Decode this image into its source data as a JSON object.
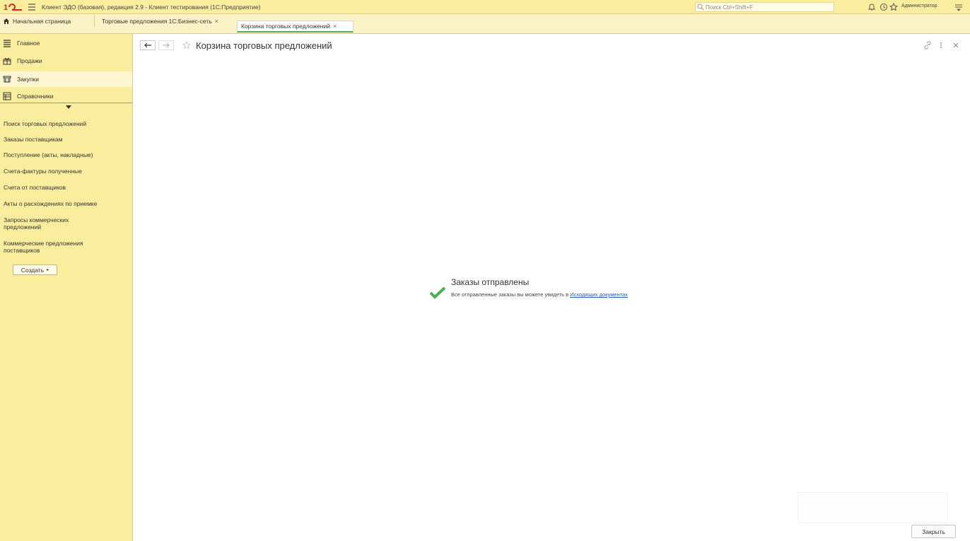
{
  "titlebar": {
    "app_title": "Клиент ЭДО (базовая), редакция 2.9 - Клиент тестирования (1С:Предприятие)",
    "search_placeholder": "Поиск Ctrl+Shift+F",
    "user": "Администратор"
  },
  "tabs": [
    {
      "label": "Начальная страница"
    },
    {
      "label": "Торговые предложения 1С:Бизнес-сеть",
      "close": "×"
    },
    {
      "label": "Корзина торговых предложений",
      "close": "×"
    }
  ],
  "sidebar": {
    "sections": [
      {
        "label": "Главное",
        "icon": "list-icon"
      },
      {
        "label": "Продажи",
        "icon": "gift-icon"
      },
      {
        "label": "Закупки",
        "icon": "cart-icon",
        "active": true
      },
      {
        "label": "Справочники",
        "icon": "catalog-icon"
      }
    ],
    "links": [
      "Поиск торговых предложений",
      "Заказы поставщикам",
      "Поступление (акты, накладные)",
      "Счета-фактуры полученные",
      "Счета от поставщиков",
      "Акты о расхождениях по приемке",
      "Запросы коммерческих предложений",
      "Коммерческие предложения поставщиков"
    ],
    "create_button": "Создать"
  },
  "main": {
    "title": "Корзина торговых предложений",
    "message_title": "Заказы отправлены",
    "message_text": "Все отправленные заказы вы можете увидеть в ",
    "message_link": "Исходящих документах",
    "close_button": "Закрыть"
  },
  "colors": {
    "panel": "#fbed9e",
    "accent_green": "#4caf50",
    "link": "#2a5daa"
  }
}
